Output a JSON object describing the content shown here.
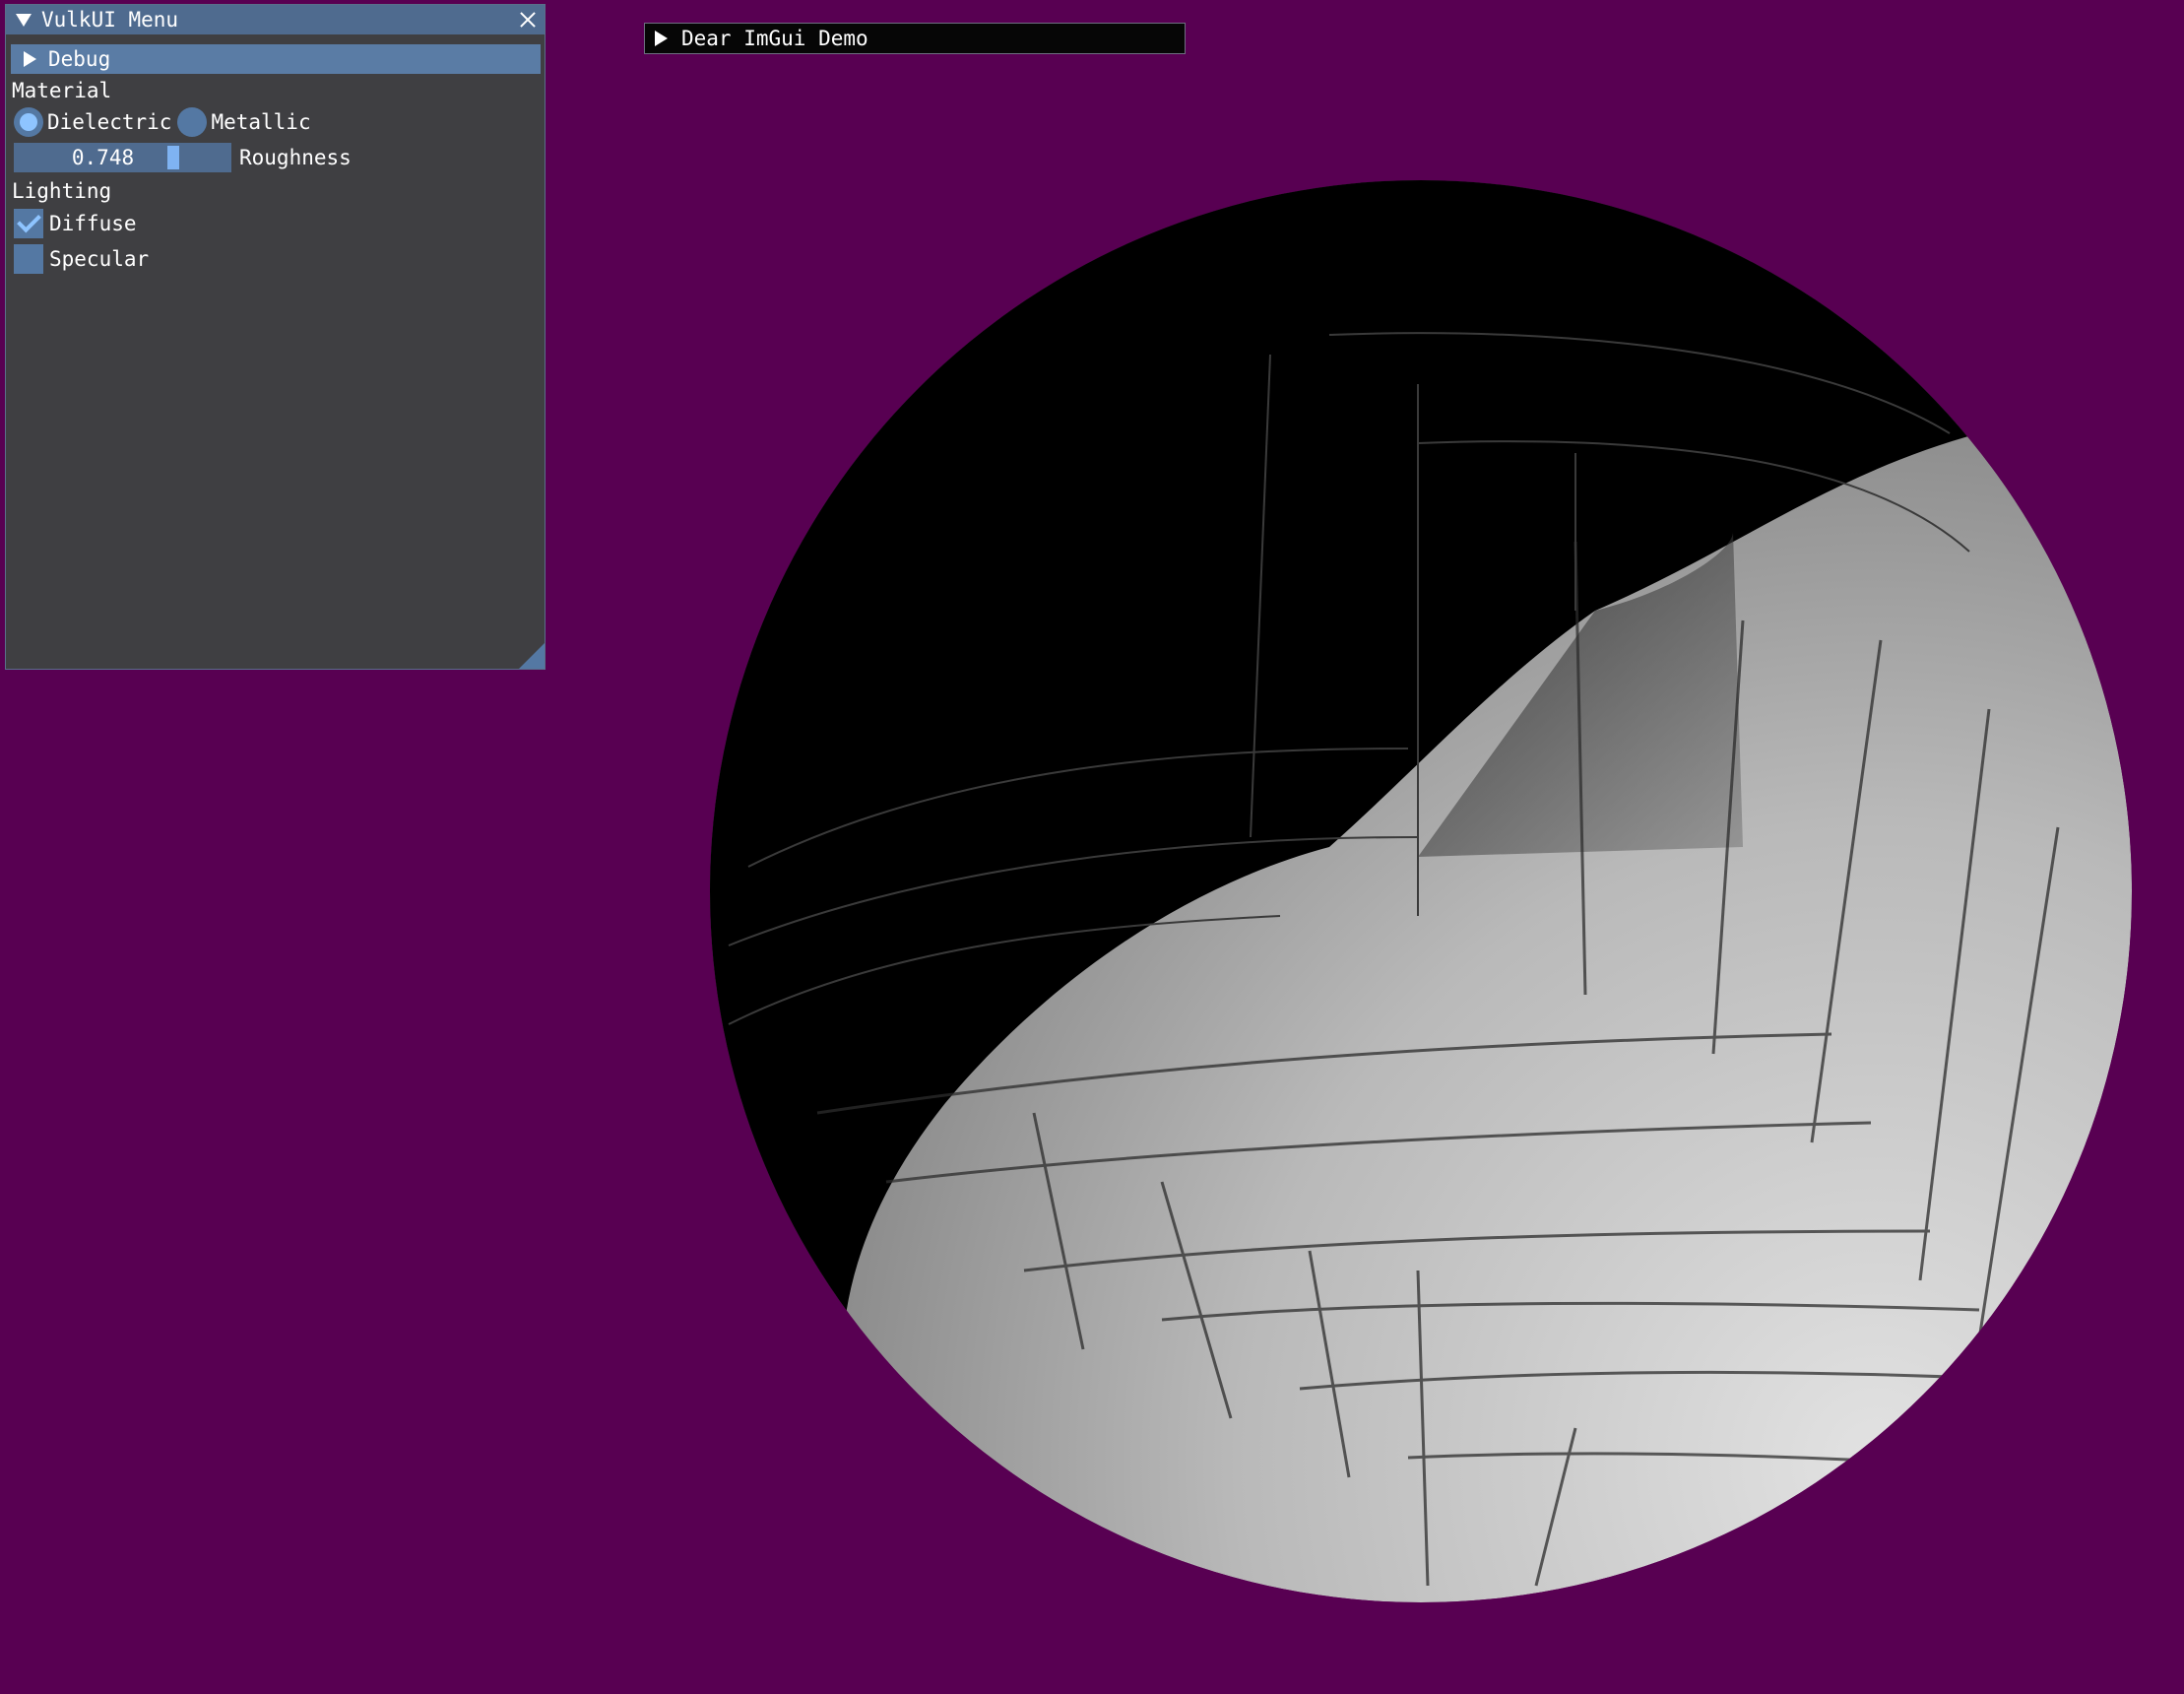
{
  "colors": {
    "background": "#580052",
    "window_bg": "#3f3f42",
    "title_bar": "#4f6b8f",
    "header": "#5a7ca5",
    "widget": "#5478a3",
    "accent": "#8ec4ff"
  },
  "menu_window": {
    "title": "VulkUI Menu",
    "debug_header": "Debug",
    "material_label": "Material",
    "radio_options": [
      {
        "label": "Dielectric",
        "selected": true
      },
      {
        "label": "Metallic",
        "selected": false
      }
    ],
    "roughness": {
      "value_text": "0.748",
      "label": "Roughness",
      "value": 0.748
    },
    "lighting_label": "Lighting",
    "checkboxes": [
      {
        "label": "Diffuse",
        "checked": true
      },
      {
        "label": "Specular",
        "checked": false
      }
    ]
  },
  "demo_window": {
    "title": "Dear ImGui Demo"
  },
  "scene": {
    "object": "sphere",
    "texture": "herringbone-parquet",
    "icons": [
      "collapse-arrow-icon",
      "close-icon",
      "expand-arrow-icon",
      "resize-grip-icon"
    ]
  }
}
